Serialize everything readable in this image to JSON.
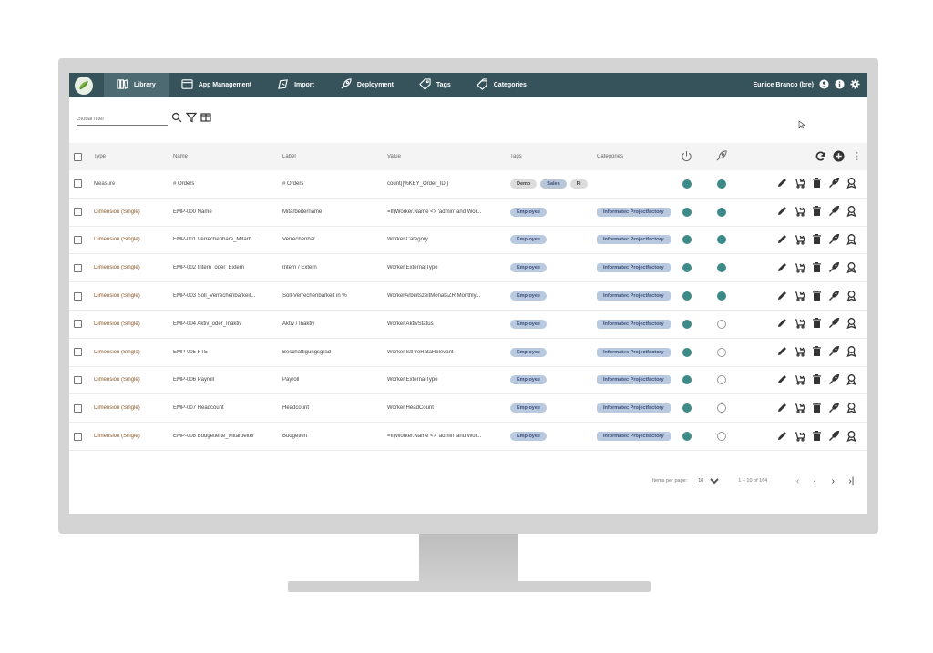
{
  "nav": {
    "items": [
      {
        "label": "Library",
        "icon": "library-icon",
        "active": true
      },
      {
        "label": "App Management",
        "icon": "window-icon",
        "active": false
      },
      {
        "label": "Import",
        "icon": "import-icon",
        "active": false
      },
      {
        "label": "Deployment",
        "icon": "rocket-icon",
        "active": false
      },
      {
        "label": "Tags",
        "icon": "tag-icon",
        "active": false
      },
      {
        "label": "Categories",
        "icon": "category-icon",
        "active": false
      }
    ],
    "user": "Eunice Branco (bre)"
  },
  "filter": {
    "placeholder": "Global filter"
  },
  "table": {
    "headers": {
      "type": "Type",
      "name": "Name",
      "label": "Label",
      "value": "Value",
      "tags": "Tags",
      "categories": "Categories"
    },
    "rows": [
      {
        "type": "Measure",
        "name": "# Orders",
        "label": "# Orders",
        "value": "count([%KEY_Order_ID])",
        "tags": [
          "Demo",
          "Sales",
          "Fi"
        ],
        "category": "",
        "active": true,
        "deployed": true
      },
      {
        "type": "Dimension (Single)",
        "name": "EMP-000 Name",
        "label": "Mitarbeitername",
        "value": "=If(Worker.Name <> 'admin' and Wor...",
        "tags": [
          "Employee"
        ],
        "category": "Informatec Projectfactory",
        "active": true,
        "deployed": true
      },
      {
        "type": "Dimension (Single)",
        "name": "EMP-001 Verrechenbare_Mitarb...",
        "label": "Verrechenbar",
        "value": "Worker.Category",
        "tags": [
          "Employee"
        ],
        "category": "Informatec Projectfactory",
        "active": true,
        "deployed": true
      },
      {
        "type": "Dimension (Single)",
        "name": "EMP-002 Intern_oder_Extern",
        "label": "Intern / Extern",
        "value": "Worker.ExternalType",
        "tags": [
          "Employee"
        ],
        "category": "Informatec Projectfactory",
        "active": true,
        "deployed": true
      },
      {
        "type": "Dimension (Single)",
        "name": "EMP-003 Soll_Verrechenbarkeit...",
        "label": "Soll-Verrechenbarkeit in %",
        "value": "WorkerArbeitszeitMonatsZR.Monthly...",
        "tags": [
          "Employee"
        ],
        "category": "Informatec Projectfactory",
        "active": true,
        "deployed": true
      },
      {
        "type": "Dimension (Single)",
        "name": "EMP-004 Aktiv_oder_Inaktiv",
        "label": "Aktiv / Inaktiv",
        "value": "Worker.AktivStatus",
        "tags": [
          "Employee"
        ],
        "category": "Informatec Projectfactory",
        "active": true,
        "deployed": false
      },
      {
        "type": "Dimension (Single)",
        "name": "EMP-005 FTE",
        "label": "Beschäftigungsgrad",
        "value": "Worker.IstProRataRelevant",
        "tags": [
          "Employee"
        ],
        "category": "Informatec Projectfactory",
        "active": true,
        "deployed": false
      },
      {
        "type": "Dimension (Single)",
        "name": "EMP-006 Payroll",
        "label": "Payroll",
        "value": "Worker.ExternalType",
        "tags": [
          "Employee"
        ],
        "category": "Informatec Projectfactory",
        "active": true,
        "deployed": false
      },
      {
        "type": "Dimension (Single)",
        "name": "EMP-007 Headcount",
        "label": "Headcount",
        "value": "Worker.HeadCount",
        "tags": [
          "Employee"
        ],
        "category": "Informatec Projectfactory",
        "active": true,
        "deployed": false
      },
      {
        "type": "Dimension (Single)",
        "name": "EMP-008 Budgetierte_Mitarbeiter",
        "label": "Budgetiert",
        "value": "=If(Worker.Name <> 'admin' and Wor...",
        "tags": [
          "Employee"
        ],
        "category": "Informatec Projectfactory",
        "active": true,
        "deployed": false
      }
    ]
  },
  "pager": {
    "items_label": "Items per page:",
    "per_page": "10",
    "range": "1 – 10 of 164"
  },
  "colors": {
    "nav": "#36525b",
    "active_dot": "#3d8b89",
    "chip": "#b9c9e0"
  }
}
